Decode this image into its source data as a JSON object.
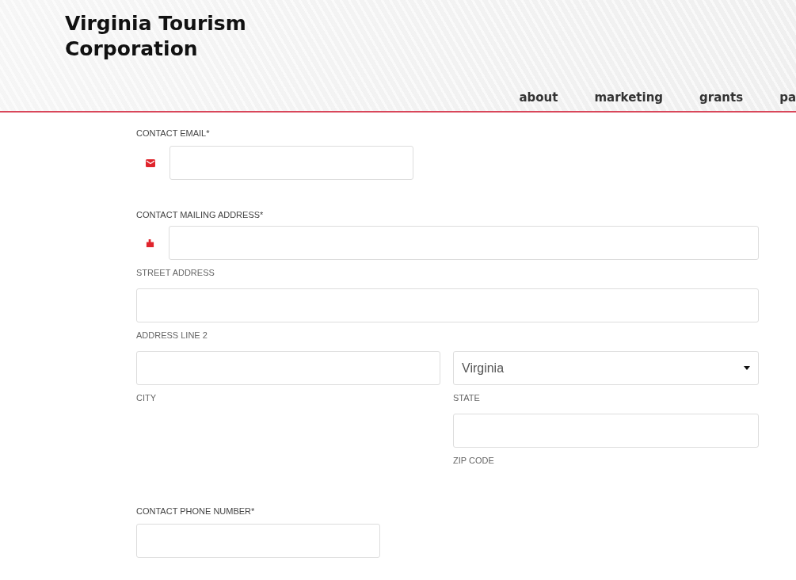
{
  "site": {
    "title": "Virginia Tourism Corporation"
  },
  "nav": [
    {
      "label": "about"
    },
    {
      "label": "marketing"
    },
    {
      "label": "grants"
    },
    {
      "label": "pa"
    }
  ],
  "form": {
    "email": {
      "label": "CONTACT EMAIL*"
    },
    "address": {
      "label": "CONTACT MAILING ADDRESS*",
      "street_caption": "STREET ADDRESS",
      "line2_caption": "ADDRESS LINE 2",
      "city_caption": "CITY",
      "state": {
        "value": "Virginia",
        "caption": "STATE"
      },
      "zip_caption": "ZIP CODE"
    },
    "phone": {
      "label": "CONTACT PHONE NUMBER*"
    }
  }
}
